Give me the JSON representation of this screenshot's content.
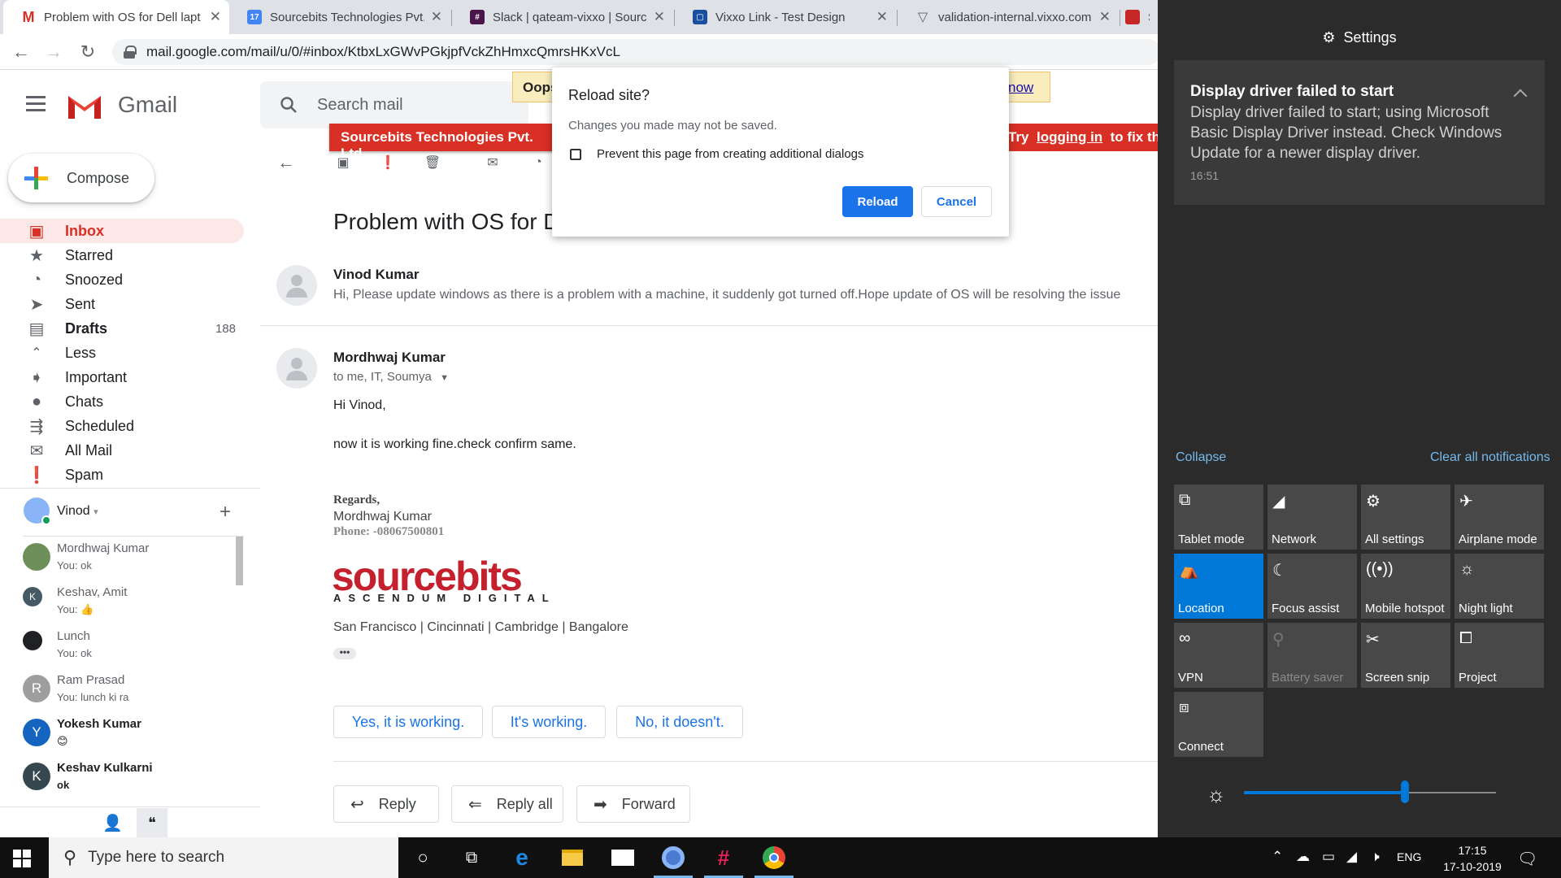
{
  "tabs": [
    {
      "title": "Problem with OS for Dell lapt",
      "icon": "gmail-icon",
      "active": true
    },
    {
      "title": "Sourcebits Technologies Pvt.",
      "icon": "calendar-icon"
    },
    {
      "title": "Slack | qateam-vixxo | Sourcel",
      "icon": "slack-icon"
    },
    {
      "title": "Vixxo Link - Test Design",
      "icon": "vixxo-icon"
    },
    {
      "title": "validation-internal.vixxo.com",
      "icon": "vixxo-v-icon"
    },
    {
      "title": "St",
      "icon": "generic-icon"
    }
  ],
  "url": "mail.google.com/mail/u/0/#inbox/KtbxLxGWvPGkjpfVckZhHmxcQmrsHKxVcL",
  "gmail": {
    "brand": "Gmail",
    "search_placeholder": "Search mail",
    "compose": "Compose",
    "nav": [
      {
        "label": "Inbox",
        "icon": "inbox-icon",
        "active": true
      },
      {
        "label": "Starred",
        "icon": "star-icon"
      },
      {
        "label": "Snoozed",
        "icon": "clock-icon"
      },
      {
        "label": "Sent",
        "icon": "send-icon"
      },
      {
        "label": "Drafts",
        "icon": "draft-icon",
        "count": "188",
        "bold": true
      },
      {
        "label": "Less",
        "icon": "chevron-up-icon"
      },
      {
        "label": "Important",
        "icon": "important-icon"
      },
      {
        "label": "Chats",
        "icon": "chat-icon"
      },
      {
        "label": "Scheduled",
        "icon": "scheduled-icon"
      },
      {
        "label": "All Mail",
        "icon": "mail-icon"
      },
      {
        "label": "Spam",
        "icon": "spam-icon"
      }
    ],
    "hangouts_user": "Vinod",
    "chats": [
      {
        "name": "Mordhwaj Kumar",
        "msg": "You: ok",
        "initial": "",
        "color": "#6d8f59"
      },
      {
        "name": "Keshav, Amit",
        "msg": "You: 👍",
        "initial": "K",
        "color": "#455a64"
      },
      {
        "name": "Lunch",
        "msg": "You: ok",
        "initial": "",
        "color": "#202124"
      },
      {
        "name": "Ram Prasad",
        "msg": "You: lunch ki ra",
        "initial": "R",
        "color": "#9e9e9e"
      },
      {
        "name": "Yokesh Kumar",
        "msg": "😊",
        "initial": "Y",
        "color": "#1565c0",
        "bold": true
      },
      {
        "name": "Keshav Kulkarni",
        "msg": "ok",
        "initial": "K",
        "color": "#37474f",
        "bold": true
      }
    ]
  },
  "banners": {
    "yellow_prefix": "Oops",
    "yellow_link": "now",
    "red_left": "Sourcebits Technologies Pvt. Ltd",
    "red_try": "Try",
    "red_link": "logging in",
    "red_after": "to fix the"
  },
  "mail": {
    "subject": "Problem with OS for D",
    "msg1": {
      "sender": "Vinod Kumar",
      "snippet": "Hi, Please update windows as there is a problem with a machine, it suddenly got turned off.Hope update of OS will be resolving the issue"
    },
    "msg2": {
      "sender": "Mordhwaj Kumar",
      "to": "to me, IT, Soumya",
      "greeting": "Hi Vinod,",
      "body": "now it is working fine.check confirm same.",
      "regards": "Regards,",
      "sig_name": "Mordhwaj Kumar",
      "sig_phone": "Phone: -08067500801",
      "logo": "sourcebits",
      "logo_tag": "ASCENDUM DIGITAL",
      "locations": "San Francisco | Cincinnati | Cambridge | Bangalore"
    },
    "smart_replies": [
      "Yes, it is working.",
      "It's working.",
      "No, it doesn't."
    ],
    "actions": [
      "Reply",
      "Reply all",
      "Forward"
    ]
  },
  "dialog": {
    "title": "Reload site?",
    "message": "Changes you made may not be saved.",
    "checkbox": "Prevent this page from creating additional dialogs",
    "reload": "Reload",
    "cancel": "Cancel"
  },
  "action_center": {
    "header": "Settings",
    "notification": {
      "title": "Display driver failed to start",
      "body": "Display driver failed to start; using Microsoft Basic Display Driver instead. Check Windows Update for a newer display driver.",
      "time": "16:51"
    },
    "collapse": "Collapse",
    "clear_all": "Clear all notifications",
    "quick_actions": [
      {
        "label": "Tablet mode",
        "icon": "tablet-icon"
      },
      {
        "label": "Network",
        "icon": "network-icon"
      },
      {
        "label": "All settings",
        "icon": "gear-icon"
      },
      {
        "label": "Airplane mode",
        "icon": "airplane-icon"
      },
      {
        "label": "Location",
        "icon": "location-icon",
        "on": true
      },
      {
        "label": "Focus assist",
        "icon": "moon-icon"
      },
      {
        "label": "Mobile hotspot",
        "icon": "hotspot-icon"
      },
      {
        "label": "Night light",
        "icon": "sun-icon"
      },
      {
        "label": "VPN",
        "icon": "vpn-icon"
      },
      {
        "label": "Battery saver",
        "icon": "battery-icon",
        "dim": true
      },
      {
        "label": "Screen snip",
        "icon": "snip-icon"
      },
      {
        "label": "Project",
        "icon": "project-icon"
      },
      {
        "label": "Connect",
        "icon": "connect-icon"
      }
    ],
    "brightness": 0.64
  },
  "taskbar": {
    "search_placeholder": "Type here to search",
    "lang": "ENG",
    "time": "17:15",
    "date": "17-10-2019"
  }
}
